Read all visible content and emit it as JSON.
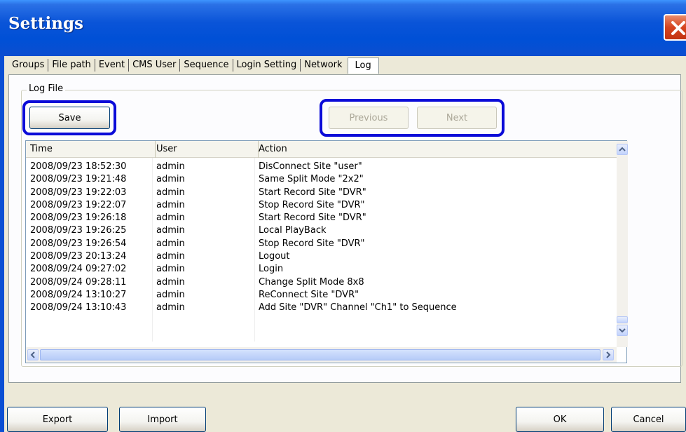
{
  "window": {
    "title": "Settings"
  },
  "tabs": [
    {
      "label": "Groups"
    },
    {
      "label": "File path"
    },
    {
      "label": "Event"
    },
    {
      "label": "CMS User"
    },
    {
      "label": "Sequence"
    },
    {
      "label": "Login Setting"
    },
    {
      "label": "Network"
    },
    {
      "label": "Log",
      "active": true
    }
  ],
  "log_file": {
    "group_label": "Log File",
    "save_label": "Save",
    "previous_label": "Previous",
    "next_label": "Next"
  },
  "table": {
    "columns": [
      "Time",
      "User",
      "Action"
    ],
    "rows": [
      [
        "2008/09/23 18:52:30",
        "admin",
        "DisConnect Site \"user\""
      ],
      [
        "2008/09/23 19:21:48",
        "admin",
        "Same Split Mode \"2x2\""
      ],
      [
        "2008/09/23 19:22:03",
        "admin",
        "Start Record Site \"DVR\""
      ],
      [
        "2008/09/23 19:22:07",
        "admin",
        "Stop Record Site \"DVR\""
      ],
      [
        "2008/09/23 19:26:18",
        "admin",
        "Start Record Site \"DVR\""
      ],
      [
        "2008/09/23 19:26:25",
        "admin",
        "Local PlayBack"
      ],
      [
        "2008/09/23 19:26:54",
        "admin",
        "Stop Record Site \"DVR\""
      ],
      [
        "2008/09/23 20:13:24",
        "admin",
        "Logout"
      ],
      [
        "2008/09/24 09:27:02",
        "admin",
        "Login"
      ],
      [
        "2008/09/24 09:28:11",
        "admin",
        "Change Split Mode 8x8"
      ],
      [
        "2008/09/24 13:10:27",
        "admin",
        "ReConnect Site \"DVR\""
      ],
      [
        "2008/09/24 13:10:43",
        "admin",
        "Add Site \"DVR\" Channel \"Ch1\" to Sequence"
      ]
    ]
  },
  "footer": {
    "export_label": "Export",
    "import_label": "Import",
    "ok_label": "OK",
    "cancel_label": "Cancel"
  },
  "colors": {
    "titlebar": "#0a54d8",
    "highlight_border": "#0b0bd8",
    "close_button": "#d6441f"
  }
}
